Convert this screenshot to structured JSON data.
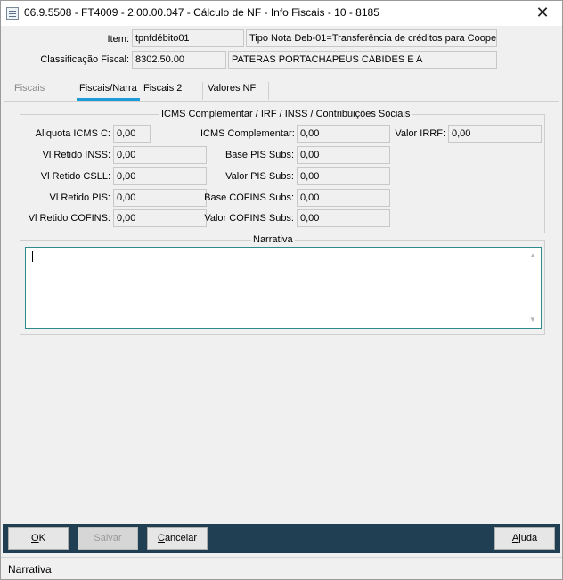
{
  "window": {
    "title": "06.9.5508 - FT4009 - 2.00.00.047 - Cálculo de NF - Info Fiscais - 10 - 8185",
    "close_glyph": "✕"
  },
  "header": {
    "item_label": "Item:",
    "item_value": "tpnfdébito01",
    "item_desc": "Tipo Nota Deb-01=Transferência de créditos para Cooper",
    "classificacao_label": "Classificação Fiscal:",
    "classificacao_value": "8302.50.00",
    "classificacao_desc": "PATERAS PORTACHAPEUS CABIDES E A"
  },
  "tabs": [
    {
      "label": "Fiscais",
      "active": false
    },
    {
      "label": "Fiscais/Narra",
      "active": true
    },
    {
      "label": "Fiscais 2",
      "active": false
    },
    {
      "label": "Valores NF",
      "active": false
    }
  ],
  "icms_group": {
    "title": "ICMS Complementar / IRF / INSS / Contribuições Sociais",
    "fields": {
      "aliquota_icms_c": {
        "label": "Aliquota ICMS C:",
        "value": "0,00"
      },
      "vl_retido_inss": {
        "label": "Vl Retido INSS:",
        "value": "0,00"
      },
      "vl_retido_csll": {
        "label": "Vl Retido CSLL:",
        "value": "0,00"
      },
      "vl_retido_pis": {
        "label": "Vl Retido PIS:",
        "value": "0,00"
      },
      "vl_retido_cofins": {
        "label": "Vl Retido COFINS:",
        "value": "0,00"
      },
      "icms_complementar": {
        "label": "ICMS Complementar:",
        "value": "0,00"
      },
      "base_pis_subs": {
        "label": "Base PIS Subs:",
        "value": "0,00"
      },
      "valor_pis_subs": {
        "label": "Valor PIS Subs:",
        "value": "0,00"
      },
      "base_cofins_subs": {
        "label": "Base COFINS Subs:",
        "value": "0,00"
      },
      "valor_cofins_subs": {
        "label": "Valor COFINS Subs:",
        "value": "0,00"
      },
      "valor_irrf": {
        "label": "Valor IRRF:",
        "value": "0,00"
      }
    }
  },
  "narrativa_group": {
    "title": "Narrativa",
    "value": ""
  },
  "buttons": {
    "ok": {
      "label": "OK",
      "mnemonic": "O",
      "rest": "K"
    },
    "salvar": {
      "label": "Salvar",
      "mnemonic": "",
      "rest": "Salvar"
    },
    "cancelar": {
      "label": "Cancelar",
      "mnemonic": "C",
      "rest": "ancelar"
    },
    "ajuda": {
      "label": "Ajuda",
      "mnemonic": "A",
      "rest": "juda"
    }
  },
  "status": {
    "text": "Narrativa"
  },
  "colors": {
    "bottom_bar": "#213f52",
    "tab_accent": "#1e9ad6",
    "textarea_border": "#2e8b8b"
  }
}
